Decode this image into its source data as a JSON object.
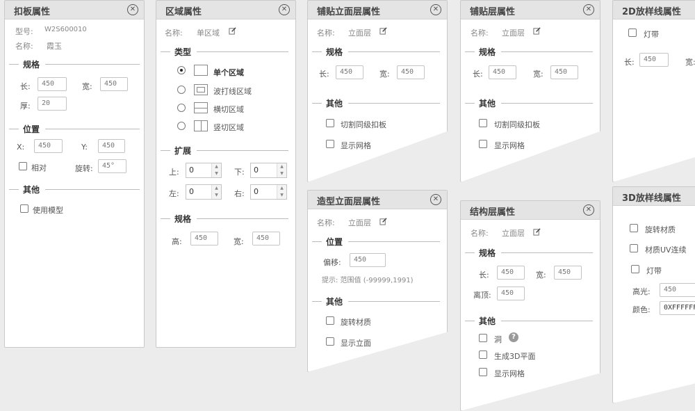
{
  "p1": {
    "title": "扣板属性",
    "model_label": "型号:",
    "model_value": "W2S600010",
    "name_label": "名称:",
    "name_value": "霞玉",
    "spec": "规格",
    "len_label": "长:",
    "len": "450",
    "wid_label": "宽:",
    "wid": "450",
    "thk_label": "厚:",
    "thk": "20",
    "pos": "位置",
    "x_label": "X:",
    "x": "450",
    "y_label": "Y:",
    "y": "450",
    "rel": "相对",
    "rot_label": "旋转:",
    "rot": "45°",
    "other": "其他",
    "use_model": "使用模型"
  },
  "p2": {
    "title": "区域属性",
    "name_label": "名称:",
    "name_value": "单区域",
    "type": "类型",
    "opt1": "单个区域",
    "opt2": "波打线区域",
    "opt3": "横切区域",
    "opt4": "竖切区域",
    "expand": "扩展",
    "up": "上:",
    "down": "下:",
    "left": "左:",
    "right": "右:",
    "up_v": "0",
    "down_v": "0",
    "left_v": "0",
    "right_v": "0",
    "spec": "规格",
    "h_label": "高:",
    "h": "450",
    "w_label": "宽:",
    "w": "450"
  },
  "p3": {
    "title": "铺贴立面层属性",
    "name_label": "名称:",
    "name_value": "立面层",
    "spec": "规格",
    "len_label": "长:",
    "len": "450",
    "wid_label": "宽:",
    "wid": "450",
    "other": "其他",
    "cb1": "切割同级扣板",
    "cb2": "显示网格"
  },
  "p4": {
    "title": "铺贴层属性",
    "name_label": "名称:",
    "name_value": "立面层",
    "spec": "规格",
    "len_label": "长:",
    "len": "450",
    "wid_label": "宽:",
    "wid": "450",
    "other": "其他",
    "cb1": "切割同级扣板",
    "cb2": "显示网格"
  },
  "p5": {
    "title": "2D放样线属性",
    "cb1": "灯带",
    "len_label": "长:",
    "len": "450",
    "wid_label": "宽:"
  },
  "p6": {
    "title": "造型立面层属性",
    "name_label": "名称:",
    "name_value": "立面层",
    "pos": "位置",
    "off_label": "偏移:",
    "off": "450",
    "hint": "提示: 范围值 (-99999,1991)",
    "other": "其他",
    "cb1": "旋转材质",
    "cb2": "显示立面"
  },
  "p7": {
    "title": "结构层属性",
    "name_label": "名称:",
    "name_value": "立面层",
    "spec": "规格",
    "len_label": "长:",
    "len": "450",
    "wid_label": "宽:",
    "wid": "450",
    "gap_label": "离顶:",
    "gap": "450",
    "other": "其他",
    "cb1": "洞",
    "cb2": "生成3D平面",
    "cb3": "显示网格"
  },
  "p8": {
    "title": "3D放样线属性",
    "cb1": "旋转材质",
    "cb2": "材质UV连续",
    "cb3": "灯带",
    "hl_label": "高光:",
    "hl": "450",
    "color_label": "颜色:",
    "color": "0XFFFFFF"
  },
  "icons": {
    "close": "close-circle-icon",
    "edit": "pencil-icon",
    "help": "question-icon"
  }
}
